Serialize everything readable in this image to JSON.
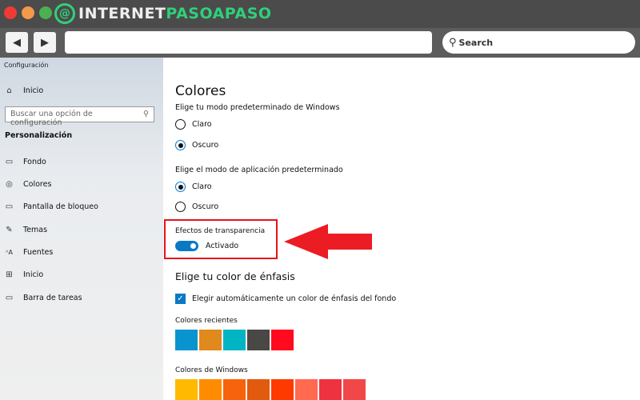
{
  "titlebar": {
    "logo_text_1": "INTERNET",
    "logo_text_2": "PASOAPASO",
    "logo_glyph": "@"
  },
  "toolbar": {
    "back_icon": "◀",
    "forward_icon": "▶",
    "search_label": "Search",
    "url_value": ""
  },
  "sidebar": {
    "app_title": "Configuración",
    "home_label": "Inicio",
    "search_placeholder": "Buscar una opción de configuración",
    "section": "Personalización",
    "items": [
      {
        "label": "Fondo",
        "icon": "image-icon"
      },
      {
        "label": "Colores",
        "icon": "palette-icon"
      },
      {
        "label": "Pantalla de bloqueo",
        "icon": "lock-screen-icon"
      },
      {
        "label": "Temas",
        "icon": "themes-icon"
      },
      {
        "label": "Fuentes",
        "icon": "fonts-icon"
      },
      {
        "label": "Inicio",
        "icon": "start-icon"
      },
      {
        "label": "Barra de tareas",
        "icon": "taskbar-icon"
      }
    ]
  },
  "main": {
    "title": "Colores",
    "windows_mode": {
      "label": "Elige tu modo predeterminado de Windows",
      "options": [
        "Claro",
        "Oscuro"
      ],
      "selected": "Oscuro"
    },
    "app_mode": {
      "label": "Elige el modo de aplicación predeterminado",
      "options": [
        "Claro",
        "Oscuro"
      ],
      "selected": "Claro"
    },
    "transparency": {
      "label": "Efectos de transparencia",
      "state": "Activado",
      "on": true
    },
    "accent": {
      "title": "Elige tu color de énfasis",
      "auto_label": "Elegir automáticamente un color de énfasis del fondo",
      "auto_checked": true
    },
    "recent": {
      "label": "Colores recientes",
      "colors": [
        "#0a94cf",
        "#e0891c",
        "#00b4c4",
        "#4a4845",
        "#ff0a1e"
      ]
    },
    "windows": {
      "label": "Colores de Windows",
      "colors": [
        "#ffb900",
        "#ff8c00",
        "#f7630c",
        "#e25a0e",
        "#ff3a00",
        "#ff6a50",
        "#ee3240",
        "#f04848"
      ]
    }
  },
  "colors": {
    "accent": "#0a79c5",
    "highlight": "#e8121c"
  }
}
